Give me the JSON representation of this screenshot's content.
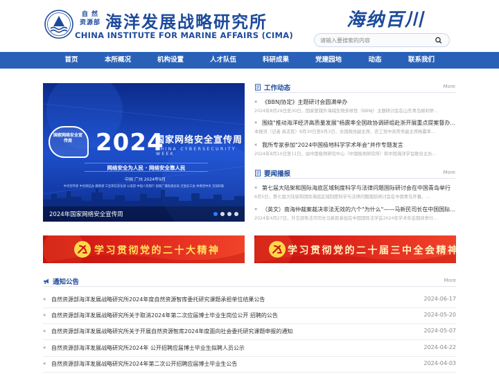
{
  "header": {
    "org_small": "自 然\n资源部",
    "institute_cn": "海洋发展战略研究所",
    "institute_en": "CHINA INSTITUTE FOR MARINE AFFAIRS (CIMA)",
    "motto": "海纳百川",
    "search_placeholder": "请输入要搜索的内容"
  },
  "nav": {
    "items": [
      "首页",
      "本所概况",
      "机构设置",
      "人才队伍",
      "科研成果",
      "党建园地",
      "动态",
      "联系我们"
    ]
  },
  "carousel": {
    "caption": "2024年国家网络安全宣传周",
    "year": "2024",
    "title": "国家网络安全宣传周",
    "subtitle_en": "CHINA CYBERSECURITY WEEK",
    "slogan": "网络安全为人民 · 网络安全靠人民",
    "place": "中国 广州    2024年9月",
    "badge": "国家网络安全宣传周",
    "orgs": "中央宣传部  中央网信办  教育部  工业和信息化部  公安部  中国人民银行  国家广播电视总局  全国总工会  共青团中央  全国妇联",
    "dots": 4,
    "active_dot": 1
  },
  "work_news": {
    "title": "工作动态",
    "more": "More",
    "items": [
      {
        "title": "《BBNJ协定》主题研讨会圆满举办",
        "summary": "2024年8月29日至30日，国家管辖外海域生物多样性（BBNJ）主题研讨会在山东青岛顺利举..."
      },
      {
        "title": "围绕\"推动海洋经济高质量发展\"杨震率全国政协调研组赴浙开展重点提案督办...",
        "summary": "本报讯（记者 高志民）8月30日至9月3日，全国政协副主席、农工党中央常务副主席杨震率..."
      },
      {
        "title": "我所专家参加\"2024中国极地科学学术年会\"并作专题发言",
        "summary": "2024年8月10日至11日，由中国极地研究中心（中国极地研究所）和中国海洋学会联合主办..."
      }
    ]
  },
  "news_broadcast": {
    "title": "要闻播报",
    "more": "More",
    "items": [
      {
        "title": "第七届大陆架和国际海底区域制度科学与法律问题国际研讨会在中国青岛举行",
        "summary": "6月5日，第七届大陆架和国际海底区域制度科学与法律问题国际研讨会在中国青岛开幕，..."
      },
      {
        "title": "（英文）南海仲裁案裁决非法无效的六个\"为什么\"——马新民司长在中国国际...",
        "summary": "2024年4月27日，外交部条法司司长马新民参加在中国国际法学会2024年学术年会期间举行..."
      }
    ]
  },
  "red_banners": [
    {
      "text": "学习贯彻党的二十大精神"
    },
    {
      "text": "学习贯彻党的二十届三中全会精神"
    }
  ],
  "notices": {
    "title": "通知公告",
    "more": "More",
    "items": [
      {
        "title": "自然资源部海洋发展战略研究所2024年度自然资源智库委托研究课题承担单位结果公告",
        "date": "2024-06-17"
      },
      {
        "title": "自然资源部海洋发展战略研究所关于取消2024年第二次应届博士毕业生岗位公开 招聘的公告",
        "date": "2024-05-20"
      },
      {
        "title": "自然资源部海洋发展战略研究所关于开展自然资源智库2024年度面向社会委托研究课题申报的通知",
        "date": "2024-05-07"
      },
      {
        "title": "自然资源部海洋发展战略研究所2024年 公开招聘应届博士毕业生拟聘人员公示",
        "date": "2024-04-22"
      },
      {
        "title": "自然资源部海洋发展战略研究所2024年第二次公开招聘应届博士毕业生公告",
        "date": "2024-04-03"
      }
    ]
  },
  "colors": {
    "brand_blue": "#1d4a9c",
    "nav_blue": "#2a61b8",
    "banner_red": "#d81e16",
    "banner_gold": "#ffe15a"
  }
}
